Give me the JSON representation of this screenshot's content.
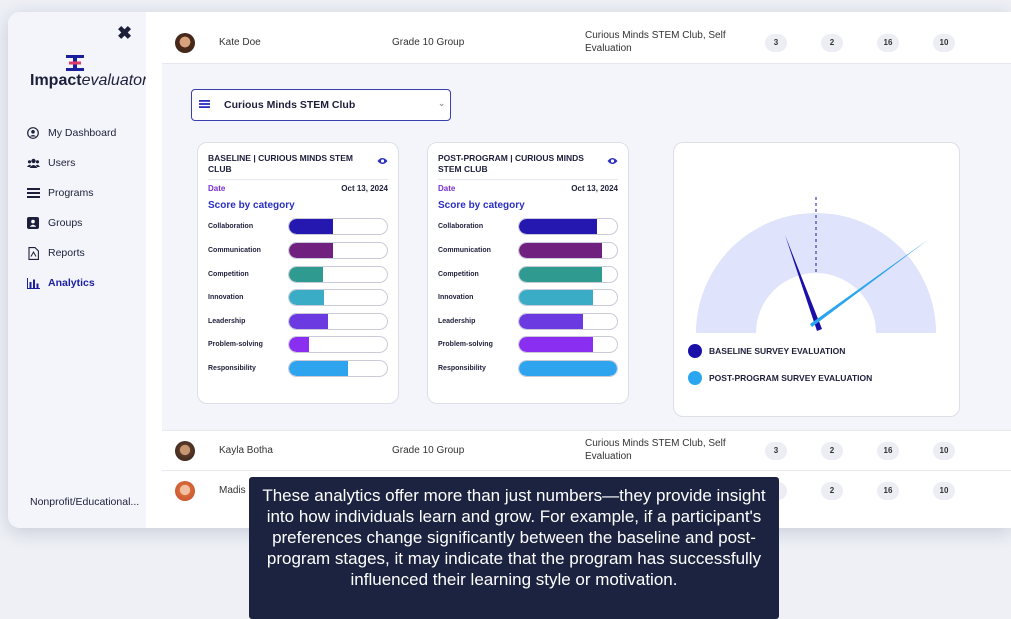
{
  "sidebar": {
    "close_label": "✖",
    "logo": {
      "bold": "Impact",
      "italic": "evaluator"
    },
    "items": [
      {
        "label": "My Dashboard",
        "icon": "user-circle-icon"
      },
      {
        "label": "Users",
        "icon": "users-icon"
      },
      {
        "label": "Programs",
        "icon": "list-icon"
      },
      {
        "label": "Groups",
        "icon": "group-icon"
      },
      {
        "label": "Reports",
        "icon": "file-icon"
      },
      {
        "label": "Analytics",
        "icon": "bar-chart-icon"
      }
    ],
    "footer": "Nonprofit/Educational..."
  },
  "rows": [
    {
      "name": "Kate Doe",
      "group": "Grade 10 Group",
      "programs": "Curious Minds STEM Club, Self Evaluation",
      "counts": [
        "3",
        "2",
        "16",
        "10"
      ]
    },
    {
      "name": "Kayla Botha",
      "group": "Grade 10 Group",
      "programs": "Curious Minds STEM Club, Self Evaluation",
      "counts": [
        "3",
        "2",
        "16",
        "10"
      ]
    },
    {
      "name": "Madis",
      "counts": [
        "3",
        "2",
        "16",
        "10"
      ]
    }
  ],
  "detail": {
    "program_select": "Curious Minds STEM Club",
    "baseline": {
      "title": "BASELINE | CURIOUS MINDS STEM CLUB",
      "date_label": "Date",
      "date": "Oct 13, 2024",
      "score_title": "Score by category"
    },
    "post": {
      "title": "POST-PROGRAM | CURIOUS MINDS STEM CLUB",
      "date_label": "Date",
      "date": "Oct 13, 2024",
      "score_title": "Score by category"
    },
    "categories": [
      {
        "name": "Collaboration",
        "color": "#2418b0",
        "baseline": 0.45,
        "post": 0.8
      },
      {
        "name": "Communication",
        "color": "#70207e",
        "baseline": 0.45,
        "post": 0.85
      },
      {
        "name": "Competition",
        "color": "#2f9a90",
        "baseline": 0.35,
        "post": 0.85
      },
      {
        "name": "Innovation",
        "color": "#3aacc6",
        "baseline": 0.36,
        "post": 0.76
      },
      {
        "name": "Leadership",
        "color": "#6b3ae0",
        "baseline": 0.4,
        "post": 0.65
      },
      {
        "name": "Problem-solving",
        "color": "#8a2ef2",
        "baseline": 0.2,
        "post": 0.75
      },
      {
        "name": "Responsibility",
        "color": "#2ea3ee",
        "baseline": 0.6,
        "post": 1.0
      }
    ],
    "gauge": {
      "baseline_legend": "BASELINE SURVEY EVALUATION",
      "post_legend": "POST-PROGRAM SURVEY EVALUATION",
      "baseline_color": "#1a0fa8",
      "post_color": "#2aa5f0"
    }
  },
  "tooltip": "These analytics offer more than just numbers—they provide insight into how individuals learn and grow. For example, if a participant's preferences change significantly between the baseline and post-program stages, it may indicate that the program has successfully influenced their learning style or motivation."
}
